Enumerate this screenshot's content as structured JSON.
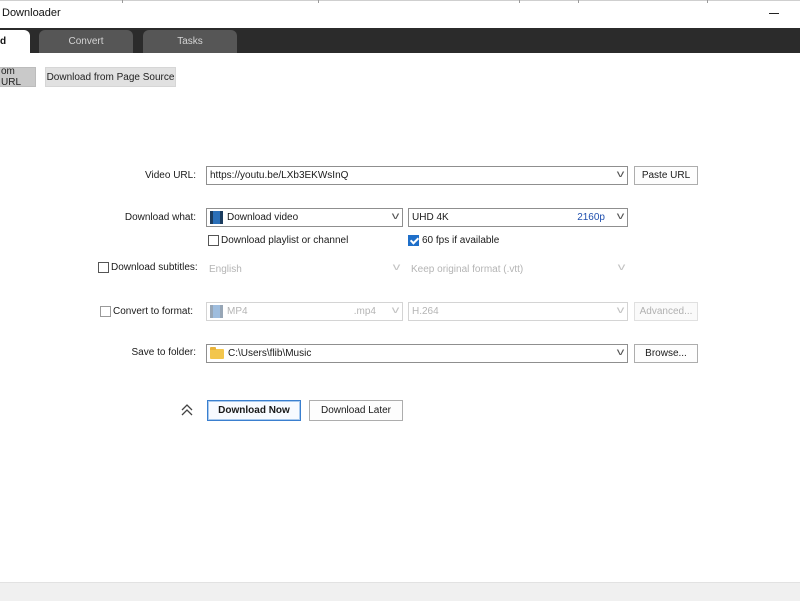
{
  "window": {
    "title": "Downloader",
    "minimize_glyph": "—"
  },
  "tabs": [
    {
      "label": "d",
      "active": true
    },
    {
      "label": "Convert",
      "active": false
    },
    {
      "label": "Tasks",
      "active": false
    }
  ],
  "subtabs": [
    {
      "label": "om URL",
      "active": true
    },
    {
      "label": "Download from Page Source",
      "active": false
    }
  ],
  "form": {
    "video_url": {
      "label": "Video URL:",
      "value": "https://youtu.be/LXb3EKWsInQ",
      "paste_button": "Paste URL"
    },
    "download_what": {
      "label": "Download what:",
      "type_value": "Download video",
      "type_icon": "film-icon",
      "quality_value": "UHD 4K",
      "quality_resolution": "2160p",
      "playlist_checkbox": {
        "label": "Download playlist or channel",
        "checked": false
      },
      "fps_checkbox": {
        "label": "60 fps if available",
        "checked": true
      }
    },
    "subtitles": {
      "checkbox_label": "Download subtitles:",
      "checked": false,
      "language_value": "English",
      "format_value": "Keep original format (.vtt)"
    },
    "convert": {
      "checkbox_label": "Convert to format:",
      "checked": false,
      "format_value": "MP4",
      "format_ext": ".mp4",
      "codec_value": "H.264",
      "advanced_button": "Advanced..."
    },
    "save_folder": {
      "label": "Save to folder:",
      "value": "C:\\Users\\flib\\Music",
      "icon": "folder-icon",
      "browse_button": "Browse..."
    }
  },
  "actions": {
    "collapse_icon": "chevron-double-up-icon",
    "download_now": "Download Now",
    "download_later": "Download Later"
  },
  "colors": {
    "tab_strip": "#2b2b2b",
    "checkbox_checked": "#1f6fc9",
    "resolution_text": "#1f4fae"
  }
}
